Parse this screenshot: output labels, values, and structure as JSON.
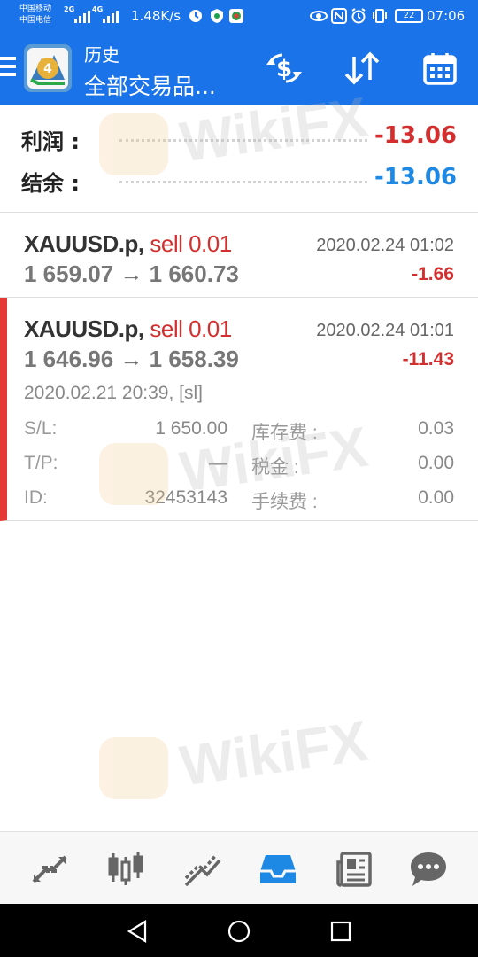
{
  "status_bar": {
    "carrier_1": "中国移动",
    "carrier_2": "中国电信",
    "net_1": "2G",
    "net_2": "4G",
    "speed": "1.48K/s",
    "battery": "22",
    "time": "07:06"
  },
  "toolbar": {
    "title": "历史",
    "subtitle": "全部交易品..."
  },
  "summary": {
    "profit_label": "利润 :",
    "profit_value": "-13.06",
    "balance_label": "结余 :",
    "balance_value": "-13.06",
    "colors": {
      "profit": "#d32f2f",
      "balance": "#1e88e5"
    }
  },
  "deals": [
    {
      "symbol": "XAUUSD.p,",
      "side": "sell 0.01",
      "time": "2020.02.24 01:02",
      "prices": "1 659.07 → 1 660.73",
      "profit": "-1.66"
    },
    {
      "symbol": "XAUUSD.p,",
      "side": "sell 0.01",
      "time": "2020.02.24 01:01",
      "prices": "1 646.96 → 1 658.39",
      "profit": "-11.43",
      "open_info": "2020.02.21 20:39, [sl]",
      "details": {
        "sl_label": "S/L:",
        "sl_value": "1 650.00",
        "tp_label": "T/P:",
        "tp_value": "—",
        "id_label": "ID:",
        "id_value": "32453143",
        "swap_label": "库存费 :",
        "swap_value": "0.03",
        "tax_label": "税金 :",
        "tax_value": "0.00",
        "fee_label": "手续费 :",
        "fee_value": "0.00"
      }
    }
  ],
  "watermark": {
    "text": "WikiFX"
  },
  "bottom_nav": [
    "quotes-icon",
    "chart-icon",
    "trade-icon",
    "history-icon",
    "news-icon",
    "chat-icon"
  ],
  "accent_color": "#1a73e8"
}
